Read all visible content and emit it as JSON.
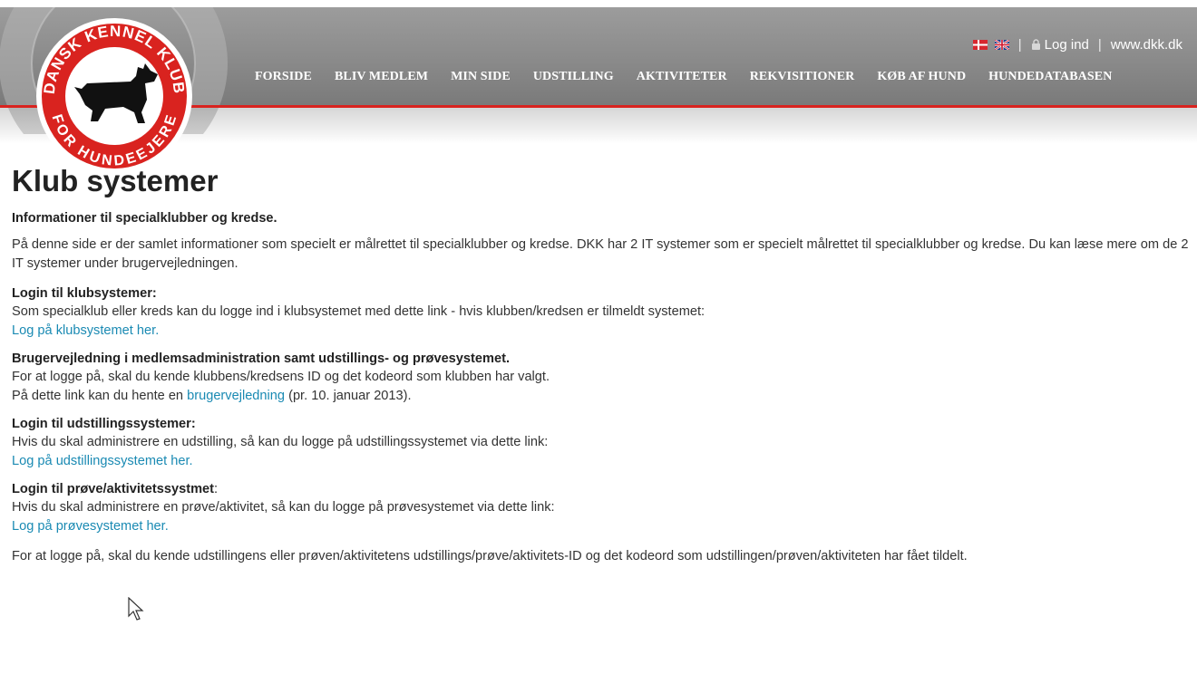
{
  "header": {
    "nav": [
      "FORSIDE",
      "BLIV MEDLEM",
      "MIN SIDE",
      "UDSTILLING",
      "AKTIVITETER",
      "REKVISITIONER",
      "KØB AF HUND",
      "HUNDEDATABASEN"
    ],
    "login_label": "Log ind",
    "site_link": "www.dkk.dk",
    "separator": "|",
    "logo": {
      "top_text": "DANSK KENNEL KLUB",
      "bottom_text": "FOR HUNDEEJERE",
      "icon": "scottish-terrier-icon"
    },
    "flags": [
      "danish-flag-icon",
      "uk-flag-icon"
    ],
    "colors": {
      "accent_red": "#d9231f",
      "header_gray": "#8f8f8f",
      "link_blue": "#1a8ab3"
    }
  },
  "page": {
    "title": "Klub systemer",
    "subtitle": "Informationer til specialklubber og kredse.",
    "intro": "På denne side er der samlet informationer som specielt er målrettet til specialklubber og kredse. DKK har 2 IT systemer som er specielt målrettet til specialklubber og kredse. Du kan læse mere om de 2 IT systemer under brugervejledningen.",
    "sections": {
      "klub": {
        "heading": "Login til klubsystemer:",
        "text": "Som specialklub eller kreds kan du logge ind i klubsystemet med dette link - hvis klubben/kredsen er tilmeldt systemet:",
        "link": "Log på klubsystemet her."
      },
      "guide": {
        "heading": "Brugervejledning i medlemsadministration samt udstillings- og prøvesystemet.",
        "line1": "For at logge på, skal du kende klubbens/kredsens ID og det kodeord som klubben har valgt.",
        "line2_before": "På dette link kan du hente en ",
        "line2_link": "brugervejledning",
        "line2_after": " (pr. 10. januar 2013)."
      },
      "udstilling": {
        "heading": "Login til udstillingssystemer:",
        "text": "Hvis du skal administrere en udstilling, så kan du logge på udstillingssystemet via dette link:",
        "link": "Log på udstillingssystemet her."
      },
      "proeve": {
        "heading": "Login til prøve/aktivitetssystmet",
        "heading_suffix": ":",
        "text": "Hvis du skal administrere en prøve/aktivitet, så kan du logge på prøvesystemet via dette link:",
        "link": "Log på prøvesystemet her."
      },
      "footer_note": "For at logge på, skal du kende udstillingens eller prøven/aktivitetens udstillings/prøve/aktivitets-ID og det kodeord som udstillingen/prøven/aktiviteten har fået tildelt."
    }
  }
}
